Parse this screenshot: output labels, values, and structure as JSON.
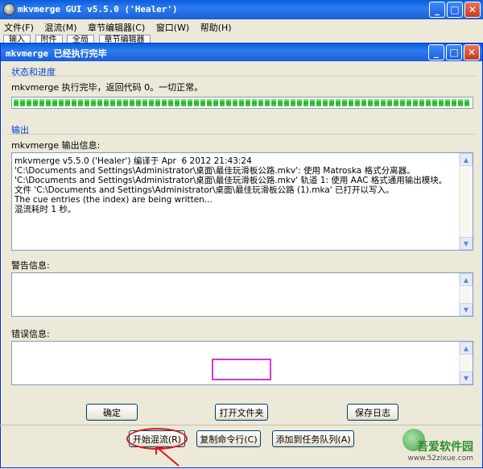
{
  "outer_window": {
    "title": "mkvmerge GUI v5.5.0 ('Healer')"
  },
  "menu": [
    "文件(F)",
    "混流(M)",
    "章节编辑器(C)",
    "窗口(W)",
    "帮助(H)"
  ],
  "tabs": [
    "输入",
    "附件",
    "全局",
    "章节编辑器"
  ],
  "dialog": {
    "title": "mkvmerge 已经执行完毕",
    "status_group": "状态和进度",
    "status_text": "mkvmerge 执行完毕，返回代码 0。一切正常。",
    "progress_percent": 100,
    "output_group": "输出",
    "output_label": "mkvmerge 输出信息:",
    "output_text": "mkvmerge v5.5.0 ('Healer') 编译于 Apr  6 2012 21:43:24\n'C:\\Documents and Settings\\Administrator\\桌面\\最佳玩滑板公路.mkv': 使用 Matroska 格式分离器。\n'C:\\Documents and Settings\\Administrator\\桌面\\最佳玩滑板公路.mkv' 轨道 1: 使用 AAC 格式通用输出模块。\n文件 'C:\\Documents and Settings\\Administrator\\桌面\\最佳玩滑板公路 (1).mka' 已打开以写入。\nThe cue entries (the index) are being written...\n混流耗时 1 秒。",
    "warning_label": "警告信息:",
    "warning_text": "",
    "error_label": "错误信息:",
    "error_text": "",
    "btn_ok": "确定",
    "btn_open_folder": "打开文件夹",
    "btn_save_log": "保存日志"
  },
  "bottom_buttons": {
    "start_mux": "开始混流(R)",
    "copy_cmdline": "复制命令行(C)",
    "add_to_queue": "添加到任务队列(A)"
  },
  "watermark": {
    "brand": "吾爱软件园",
    "url": "www.52zixue.com"
  },
  "colors": {
    "title_blue": "#1a5fd6",
    "group_label": "#0046d5",
    "progress_green": "#1fb51f",
    "annotation_red": "#d71a1a",
    "annotation_pink": "#d438c8"
  }
}
